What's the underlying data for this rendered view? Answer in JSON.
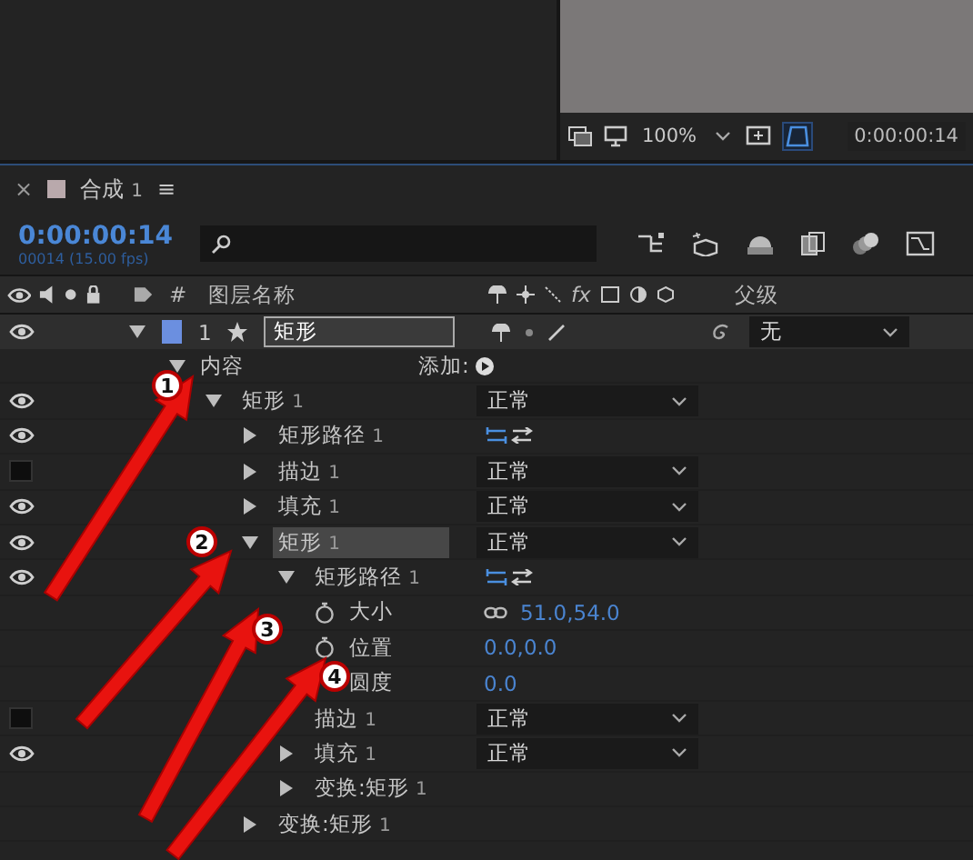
{
  "viewer": {
    "zoom": "100%",
    "timecode": "0:00:00:14"
  },
  "panel": {
    "close": "×",
    "title": "合成",
    "title_number": "1",
    "menu": "≡"
  },
  "time": {
    "timecode": "0:00:00:14",
    "frames": "00014 (15.00 fps)"
  },
  "columns": {
    "number": "#",
    "layer_name": "图层名称",
    "fx": "fx",
    "parent": "父级"
  },
  "layer": {
    "number": "1",
    "name": "矩形",
    "parent": "无",
    "eye": true
  },
  "tree": {
    "kind": "contents",
    "name": "内容",
    "add_label": "添加:",
    "children": [
      {
        "kind": "group",
        "name": "矩形",
        "index": "1",
        "eye": true,
        "expanded": true,
        "highlighted": false,
        "mode": "正常",
        "children": [
          {
            "kind": "path",
            "name": "矩形路径",
            "index": "1",
            "eye": true,
            "expanded": false,
            "highlighted": false
          },
          {
            "kind": "group",
            "name": "描边",
            "index": "1",
            "eye": false,
            "expanded": false,
            "highlighted": false,
            "mode": "正常"
          },
          {
            "kind": "group",
            "name": "填充",
            "index": "1",
            "eye": true,
            "expanded": false,
            "highlighted": false,
            "mode": "正常"
          },
          {
            "kind": "group",
            "name": "矩形",
            "index": "1",
            "eye": true,
            "expanded": true,
            "highlighted": true,
            "mode": "正常",
            "children": [
              {
                "kind": "path",
                "name": "矩形路径",
                "index": "1",
                "eye": true,
                "expanded": true,
                "highlighted": false,
                "children": [
                  {
                    "kind": "prop",
                    "name": "大小",
                    "value": "51.0,54.0",
                    "linked": true,
                    "stopwatch": true
                  },
                  {
                    "kind": "prop",
                    "name": "位置",
                    "value": "0.0,0.0",
                    "linked": false,
                    "stopwatch": true
                  },
                  {
                    "kind": "prop",
                    "name": "圆度",
                    "value": "0.0",
                    "linked": false,
                    "stopwatch": false
                  }
                ]
              },
              {
                "kind": "group",
                "name": "描边",
                "index": "1",
                "eye": false,
                "highlighted": false,
                "mode": "正常"
              },
              {
                "kind": "group",
                "name": "填充",
                "index": "1",
                "eye": true,
                "expanded": false,
                "highlighted": false,
                "mode": "正常"
              },
              {
                "kind": "transform",
                "name": "变换:矩形",
                "index": "1",
                "expanded": false
              }
            ]
          },
          {
            "kind": "transform",
            "name": "变换:矩形",
            "index": "1",
            "expanded": false
          }
        ]
      }
    ]
  },
  "annotations": [
    {
      "number": "1"
    },
    {
      "number": "2"
    },
    {
      "number": "3"
    },
    {
      "number": "4"
    }
  ]
}
